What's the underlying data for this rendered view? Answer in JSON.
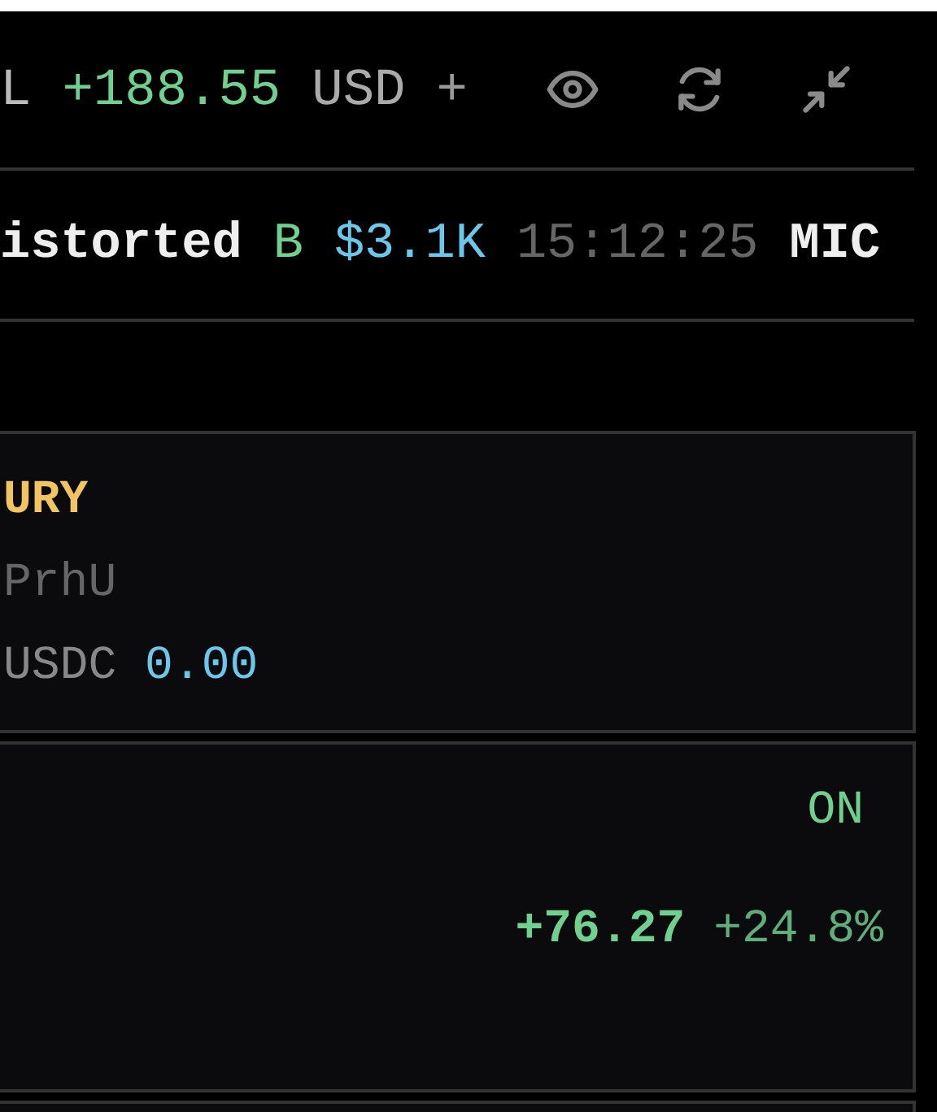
{
  "header": {
    "label": "L",
    "pnl": "+188.55",
    "currency": "USD",
    "add": "+"
  },
  "ticker": {
    "name": "istorted",
    "side": "B",
    "amount": "$3.1K",
    "time": "15:12:25",
    "next": "MIC"
  },
  "cards": [
    {
      "kind": "wallet",
      "title": "URY",
      "address": "PrhU",
      "token": "USDC",
      "balance": "0.00"
    },
    {
      "kind": "position",
      "status": "ON",
      "pnl": "+76.27",
      "pnl_pct": "+24.8%"
    }
  ]
}
